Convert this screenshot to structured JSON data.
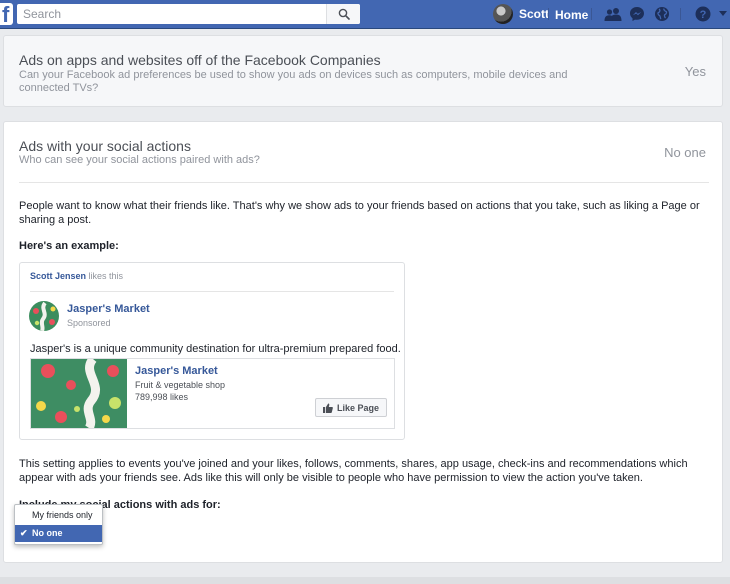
{
  "topbar": {
    "logo": "f",
    "search_placeholder": "Search",
    "user_name": "Scott",
    "home_label": "Home",
    "icons": [
      "friends-icon",
      "messenger-icon",
      "globe-icon",
      "help-icon",
      "caret-down-icon"
    ]
  },
  "card1": {
    "title": "Ads on apps and websites off of the Facebook Companies",
    "subtitle": "Can your Facebook ad preferences be used to show you ads on devices such as computers, mobile devices and connected TVs?",
    "value": "Yes"
  },
  "card2": {
    "title": "Ads with your social actions",
    "subtitle": "Who can see your social actions paired with ads?",
    "value": "No one",
    "intro": "People want to know what their friends like. That's why we show ads to your friends based on actions that you take, such as liking a Page or sharing a post.",
    "example_heading": "Here's an example:",
    "example": {
      "liker_name": "Scott Jensen",
      "liker_action": "likes this",
      "page_name": "Jasper's Market",
      "sponsored": "Sponsored",
      "description": "Jasper's is a unique community destination for ultra-premium prepared food.",
      "inner_title": "Jasper's Market",
      "category": "Fruit & vegetable shop",
      "likes": "789,998 likes",
      "like_button": "Like Page"
    },
    "setting_note": "This setting applies to events you've joined and your likes, follows, comments, shares, app usage, check-ins and recommendations which appear with ads your friends see. Ads like this will only be visible to people who have permission to view the action you've taken.",
    "include_label": "Include my social actions with ads for:",
    "dropdown": {
      "options": [
        "My friends only",
        "No one"
      ],
      "selected": "No one"
    }
  },
  "colors": {
    "brand_blue": "#4267b2",
    "link_blue": "#365899",
    "selected_bg": "#4267b2"
  }
}
